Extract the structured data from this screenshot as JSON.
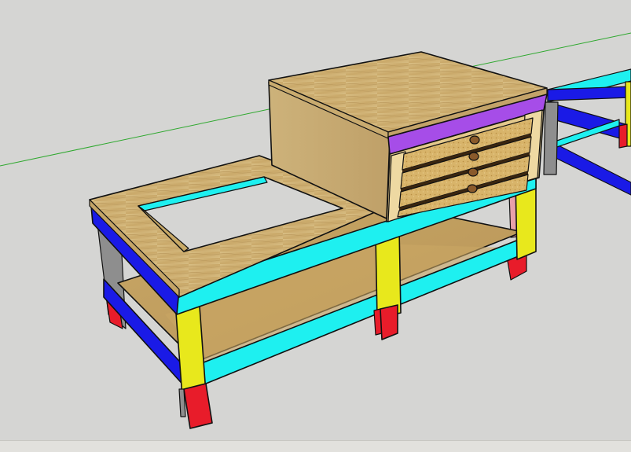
{
  "app": {
    "viewport_label": "",
    "status_text": ""
  },
  "colors": {
    "background": "#d5d5d3",
    "axis_green": "#2ea82e",
    "frame_cyan": "#1ef0f0",
    "frame_blue": "#1a1ae6",
    "leg_yellow": "#e8e81c",
    "leg_red": "#e81c2a",
    "leg_gray": "#8e8e8e",
    "leg_teal": "#178f8f",
    "leg_pink": "#e8a0a8",
    "drawer_band": "#a64de8",
    "plywood": "#d6b97a",
    "cork": "#d9b66d",
    "knob": "#8a5a2b"
  },
  "model": {
    "drawer_count": 4
  }
}
